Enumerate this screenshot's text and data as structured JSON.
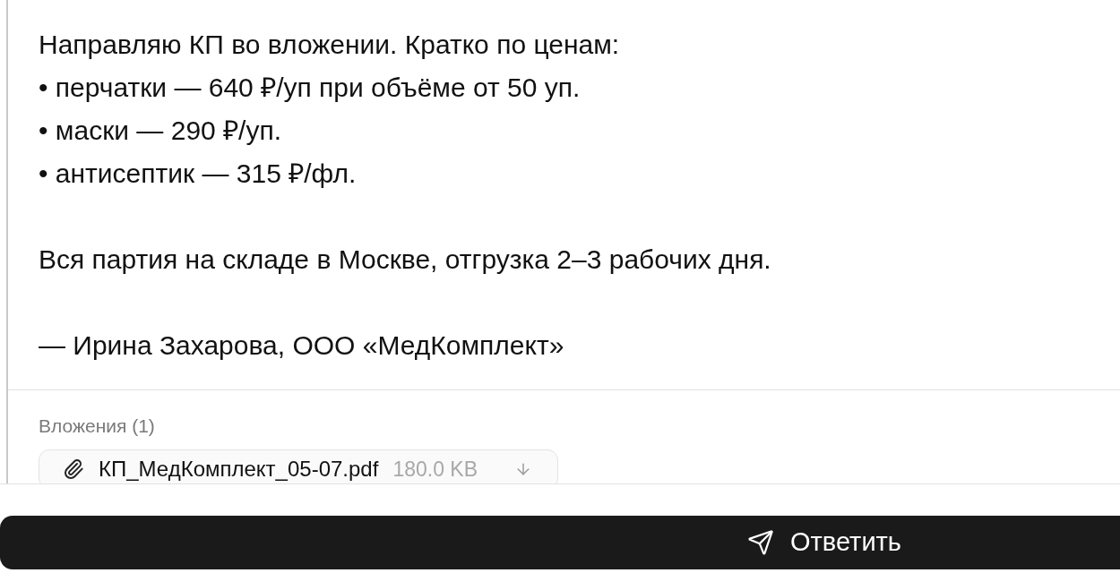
{
  "message": {
    "intro": "Направляю КП во вложении. Кратко по ценам:",
    "bullets": [
      "• перчатки — 640 ₽/уп при объёме от 50 уп.",
      "• маски — 290 ₽/уп.",
      "• антисептик — 315 ₽/фл."
    ],
    "note": "Вся партия на складе в Москве, отгрузка 2–3 рабочих дня.",
    "signature": "— Ирина Захарова, ООО «МедКомплект»"
  },
  "attachments": {
    "heading": "Вложения (1)",
    "files": [
      {
        "name": "КП_МедКомплект_05-07.pdf",
        "size": "180.0 KB"
      }
    ]
  },
  "reply_button": {
    "label": "Ответить"
  }
}
